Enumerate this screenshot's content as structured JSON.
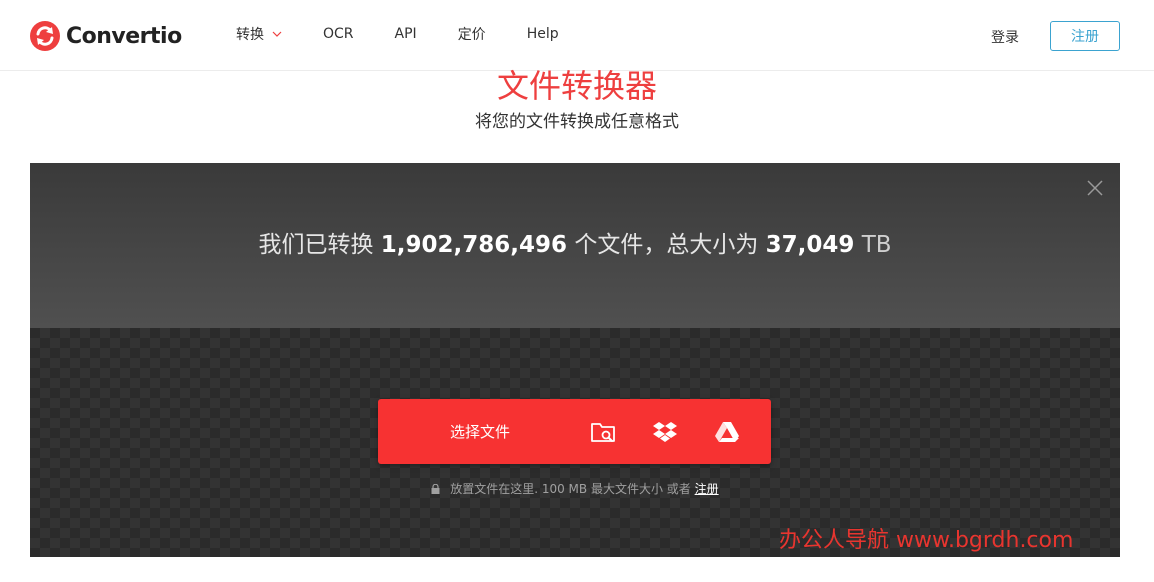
{
  "brand": {
    "name": "Convertio",
    "accent": "#ee3f3f",
    "link": "#3ba3d0"
  },
  "nav": {
    "items": [
      {
        "label": "转换",
        "has_dropdown": true
      },
      {
        "label": "OCR"
      },
      {
        "label": "API"
      },
      {
        "label": "定价"
      },
      {
        "label": "Help"
      }
    ],
    "login_label": "登录",
    "signup_label": "注册"
  },
  "hero": {
    "title": "文件转换器",
    "subtitle": "将您的文件转换成任意格式"
  },
  "stats": {
    "prefix": "我们已转换",
    "file_count": "1,902,786,496",
    "middle": "个文件，总大小为",
    "total_size": "37,049",
    "unit": "TB"
  },
  "upload": {
    "choose_label": "选择文件",
    "sources": [
      "folder-search-icon",
      "dropbox-icon",
      "google-drive-icon"
    ],
    "hint_text": "放置文件在这里. 100 MB 最大文件大小 或者",
    "hint_link": "注册"
  },
  "watermark": "办公人导航 www.bgrdh.com"
}
